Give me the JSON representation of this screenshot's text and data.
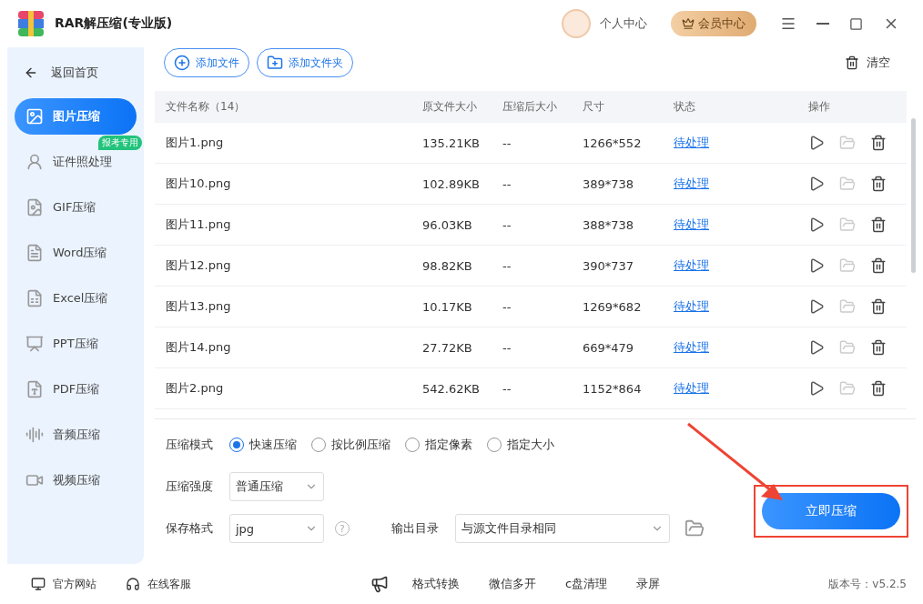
{
  "window": {
    "title": "RAR解压缩(专业版)",
    "user": "个人中心",
    "vip": "会员中心"
  },
  "sidebar": {
    "back": "返回首页",
    "items": [
      {
        "label": "图片压缩",
        "selected": true,
        "kind": "image"
      },
      {
        "label": "证件照处理",
        "selected": false,
        "kind": "id",
        "badge": "报考专用"
      },
      {
        "label": "GIF压缩",
        "selected": false,
        "kind": "gif"
      },
      {
        "label": "Word压缩",
        "selected": false,
        "kind": "word"
      },
      {
        "label": "Excel压缩",
        "selected": false,
        "kind": "excel"
      },
      {
        "label": "PPT压缩",
        "selected": false,
        "kind": "ppt"
      },
      {
        "label": "PDF压缩",
        "selected": false,
        "kind": "pdf"
      },
      {
        "label": "音频压缩",
        "selected": false,
        "kind": "audio"
      },
      {
        "label": "视频压缩",
        "selected": false,
        "kind": "video"
      }
    ]
  },
  "toolbar": {
    "add_file": "添加文件",
    "add_folder": "添加文件夹",
    "clear": "清空"
  },
  "table": {
    "columns": [
      "文件名称（14）",
      "原文件大小",
      "压缩后大小",
      "尺寸",
      "状态",
      "操作"
    ],
    "rows": [
      {
        "name": "图片1.png",
        "size": "135.21KB",
        "compressed": "--",
        "dimensions": "1266*552",
        "status": "待处理"
      },
      {
        "name": "图片10.png",
        "size": "102.89KB",
        "compressed": "--",
        "dimensions": "389*738",
        "status": "待处理"
      },
      {
        "name": "图片11.png",
        "size": "96.03KB",
        "compressed": "--",
        "dimensions": "388*738",
        "status": "待处理"
      },
      {
        "name": "图片12.png",
        "size": "98.82KB",
        "compressed": "--",
        "dimensions": "390*737",
        "status": "待处理"
      },
      {
        "name": "图片13.png",
        "size": "10.17KB",
        "compressed": "--",
        "dimensions": "1269*682",
        "status": "待处理"
      },
      {
        "name": "图片14.png",
        "size": "27.72KB",
        "compressed": "--",
        "dimensions": "669*479",
        "status": "待处理"
      },
      {
        "name": "图片2.png",
        "size": "542.62KB",
        "compressed": "--",
        "dimensions": "1152*864",
        "status": "待处理"
      }
    ]
  },
  "settings": {
    "mode_label": "压缩模式",
    "modes": [
      {
        "label": "快速压缩",
        "selected": true
      },
      {
        "label": "按比例压缩",
        "selected": false
      },
      {
        "label": "指定像素",
        "selected": false
      },
      {
        "label": "指定大小",
        "selected": false
      }
    ],
    "strength_label": "压缩强度",
    "strength": "普通压缩",
    "format_label": "保存格式",
    "format": "jpg",
    "help": "?",
    "output_label": "输出目录",
    "output": "与源文件目录相同",
    "start": "立即压缩"
  },
  "footer": {
    "website": "官方网站",
    "support": "在线客服",
    "tools": [
      "格式转换",
      "微信多开",
      "c盘清理",
      "录屏"
    ],
    "version": "版本号：v5.2.5"
  }
}
